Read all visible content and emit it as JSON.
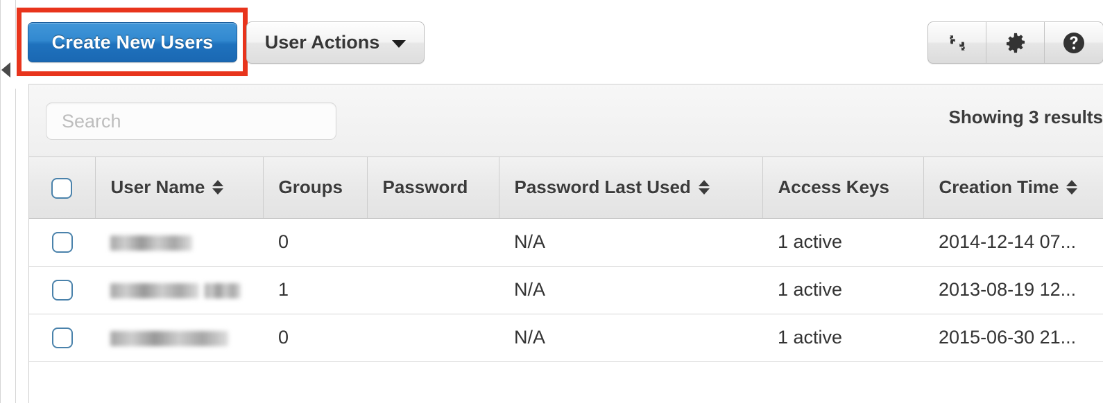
{
  "toolbar": {
    "create_button_label": "Create New Users",
    "actions_button_label": "User Actions",
    "caret_icon": "caret-down-icon",
    "highlight_color": "#e8341c",
    "primary_button_color": "#2d86cc",
    "icon_buttons": [
      {
        "name": "refresh-icon",
        "title": "Refresh"
      },
      {
        "name": "gear-icon",
        "title": "Settings"
      },
      {
        "name": "help-icon",
        "title": "Help"
      }
    ]
  },
  "sidebar": {
    "collapse_icon": "collapse-left-arrow-icon"
  },
  "search": {
    "value": "",
    "placeholder": "Search"
  },
  "results": {
    "label": "Showing 3 results"
  },
  "table": {
    "select_all_label": "",
    "columns": [
      {
        "label": "",
        "sortable": false,
        "key": "check"
      },
      {
        "label": "User Name",
        "sortable": true,
        "key": "user_name"
      },
      {
        "label": "Groups",
        "sortable": false,
        "key": "groups"
      },
      {
        "label": "Password",
        "sortable": false,
        "key": "password"
      },
      {
        "label": "Password Last Used",
        "sortable": true,
        "key": "password_last_used"
      },
      {
        "label": "Access Keys",
        "sortable": false,
        "key": "access_keys"
      },
      {
        "label": "Creation Time",
        "sortable": true,
        "key": "creation_time"
      }
    ],
    "rows": [
      {
        "user_name": "",
        "user_name_redacted": true,
        "groups": "0",
        "password": "",
        "password_last_used": "N/A",
        "access_keys": "1 active",
        "creation_time": "2014-12-14 07..."
      },
      {
        "user_name": "",
        "user_name_redacted": true,
        "groups": "1",
        "password": "",
        "password_last_used": "N/A",
        "access_keys": "1 active",
        "creation_time": "2013-08-19 12..."
      },
      {
        "user_name": "",
        "user_name_redacted": true,
        "groups": "0",
        "password": "",
        "password_last_used": "N/A",
        "access_keys": "1 active",
        "creation_time": "2015-06-30 21..."
      }
    ]
  }
}
